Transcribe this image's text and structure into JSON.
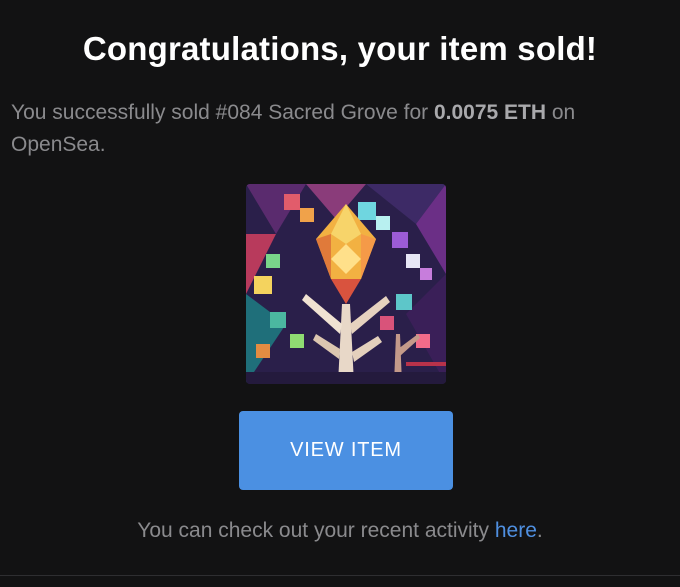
{
  "header": {
    "title": "Congratulations, your item sold!"
  },
  "message": {
    "prefix": "You successfully sold ",
    "item_name": "#084 Sacred Grove",
    "middle": " for ",
    "price": "0.0075 ETH",
    "suffix": " on OpenSea."
  },
  "item": {
    "image_alt_name": "sacred-grove-nft"
  },
  "actions": {
    "view_item_label": "VIEW ITEM"
  },
  "footer": {
    "prefix": "You can check out your recent activity ",
    "link_label": "here",
    "suffix": "."
  },
  "colors": {
    "background": "#121213",
    "button": "#4b90e2",
    "link": "#4f8fe0",
    "text_muted": "#8a8a8d"
  }
}
